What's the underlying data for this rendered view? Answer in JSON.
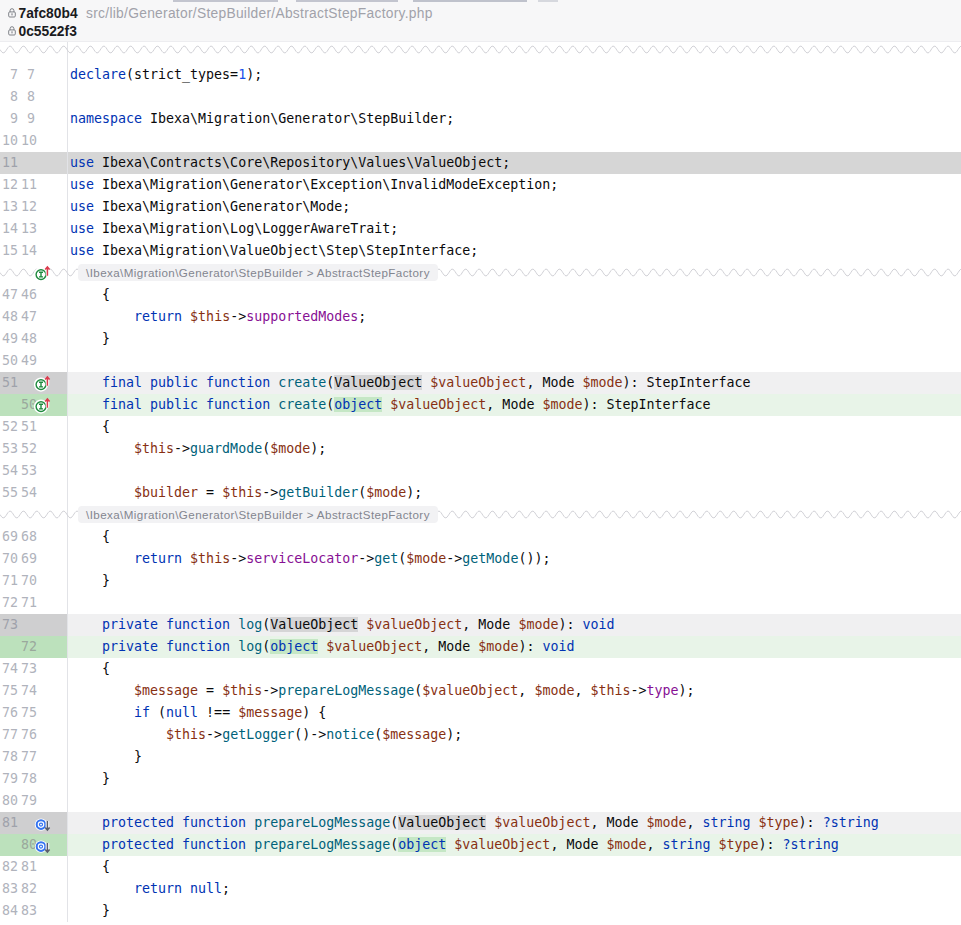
{
  "header": {
    "commit_old": "7afc80b4",
    "commit_new": "0c5522f3",
    "file_path": "src/lib/Generator/StepBuilder/AbstractStepFactory.php"
  },
  "diff_colors": {
    "deleted_line_bg": "#d6d6d6",
    "deleted_word_bg": "#d5d5d6",
    "deleted_soft_bg": "#f0f0f1",
    "added_gutter_bg": "#bce1bc",
    "added_word_bg": "#c5e7c5",
    "added_soft_bg": "#e8f4e8"
  },
  "rows": [
    {
      "t": "fold"
    },
    {
      "t": "ctx",
      "old": "7",
      "new": "7",
      "tokens": [
        [
          "keyword",
          "declare"
        ],
        [
          "plain",
          "(strict_types="
        ],
        [
          "number",
          "1"
        ],
        [
          "plain",
          ");"
        ]
      ]
    },
    {
      "t": "ctx",
      "old": "8",
      "new": "8",
      "tokens": []
    },
    {
      "t": "ctx",
      "old": "9",
      "new": "9",
      "tokens": [
        [
          "keyword",
          "namespace"
        ],
        [
          "plain",
          " Ibexa\\Migration\\Generator\\StepBuilder;"
        ]
      ]
    },
    {
      "t": "ctx",
      "old": "10",
      "new": "10",
      "tokens": []
    },
    {
      "t": "deleted",
      "old": "11",
      "tokens": [
        [
          "keyword",
          "use"
        ],
        [
          "plain",
          " Ibexa\\Contracts\\Core\\Repository\\Values\\ValueObject;"
        ]
      ]
    },
    {
      "t": "ctx",
      "old": "12",
      "new": "11",
      "tokens": [
        [
          "keyword",
          "use"
        ],
        [
          "plain",
          " Ibexa\\Migration\\Generator\\Exception\\InvalidModeException;"
        ]
      ]
    },
    {
      "t": "ctx",
      "old": "13",
      "new": "12",
      "tokens": [
        [
          "keyword",
          "use"
        ],
        [
          "plain",
          " Ibexa\\Migration\\Generator\\Mode;"
        ]
      ]
    },
    {
      "t": "ctx",
      "old": "14",
      "new": "13",
      "tokens": [
        [
          "keyword",
          "use"
        ],
        [
          "plain",
          " Ibexa\\Migration\\Log\\LoggerAwareTrait;"
        ]
      ]
    },
    {
      "t": "ctx",
      "old": "15",
      "new": "14",
      "tokens": [
        [
          "keyword",
          "use"
        ],
        [
          "plain",
          " Ibexa\\Migration\\ValueObject\\Step\\StepInterface;"
        ]
      ]
    },
    {
      "t": "fold",
      "label": "\\Ibexa\\Migration\\Generator\\StepBuilder > AbstractStepFactory",
      "icon": "implements-interface-icon"
    },
    {
      "t": "ctx",
      "old": "47",
      "new": "46",
      "tokens": [
        [
          "plain",
          "    {"
        ]
      ]
    },
    {
      "t": "ctx",
      "old": "48",
      "new": "47",
      "tokens": [
        [
          "plain",
          "        "
        ],
        [
          "keyword",
          "return"
        ],
        [
          "plain",
          " "
        ],
        [
          "variable",
          "$this"
        ],
        [
          "plain",
          "->"
        ],
        [
          "field",
          "supportedModes"
        ],
        [
          "plain",
          ";"
        ]
      ]
    },
    {
      "t": "ctx",
      "old": "49",
      "new": "48",
      "tokens": [
        [
          "plain",
          "    }"
        ]
      ]
    },
    {
      "t": "ctx",
      "old": "50",
      "new": "49",
      "tokens": []
    },
    {
      "t": "del-mod",
      "old": "51",
      "icon": "implements-interface-icon",
      "tokens": [
        [
          "plain",
          "    "
        ],
        [
          "keyword",
          "final public function "
        ],
        [
          "function",
          "create"
        ],
        [
          "plain",
          "("
        ],
        [
          "plain",
          "ValueObject",
          "changed"
        ],
        [
          "plain",
          " "
        ],
        [
          "variable",
          "$valueObject"
        ],
        [
          "plain",
          ", Mode "
        ],
        [
          "variable",
          "$mode"
        ],
        [
          "plain",
          "): StepInterface"
        ]
      ]
    },
    {
      "t": "add-mod",
      "new": "50",
      "icon": "implements-interface-icon",
      "tokens": [
        [
          "plain",
          "    "
        ],
        [
          "keyword",
          "final public function "
        ],
        [
          "function",
          "create"
        ],
        [
          "plain",
          "("
        ],
        [
          "keyword",
          "object",
          "changed"
        ],
        [
          "plain",
          " "
        ],
        [
          "variable",
          "$valueObject"
        ],
        [
          "plain",
          ", Mode "
        ],
        [
          "variable",
          "$mode"
        ],
        [
          "plain",
          "): StepInterface"
        ]
      ]
    },
    {
      "t": "ctx",
      "old": "52",
      "new": "51",
      "tokens": [
        [
          "plain",
          "    {"
        ]
      ]
    },
    {
      "t": "ctx",
      "old": "53",
      "new": "52",
      "tokens": [
        [
          "plain",
          "        "
        ],
        [
          "variable",
          "$this"
        ],
        [
          "plain",
          "->"
        ],
        [
          "function",
          "guardMode"
        ],
        [
          "plain",
          "("
        ],
        [
          "variable",
          "$mode"
        ],
        [
          "plain",
          ");"
        ]
      ]
    },
    {
      "t": "ctx",
      "old": "54",
      "new": "53",
      "tokens": []
    },
    {
      "t": "ctx",
      "old": "55",
      "new": "54",
      "tokens": [
        [
          "plain",
          "        "
        ],
        [
          "variable",
          "$builder"
        ],
        [
          "plain",
          " = "
        ],
        [
          "variable",
          "$this"
        ],
        [
          "plain",
          "->"
        ],
        [
          "function",
          "getBuilder"
        ],
        [
          "plain",
          "("
        ],
        [
          "variable",
          "$mode"
        ],
        [
          "plain",
          ");"
        ]
      ]
    },
    {
      "t": "fold",
      "label": "\\Ibexa\\Migration\\Generator\\StepBuilder > AbstractStepFactory"
    },
    {
      "t": "ctx",
      "old": "69",
      "new": "68",
      "tokens": [
        [
          "plain",
          "    {"
        ]
      ]
    },
    {
      "t": "ctx",
      "old": "70",
      "new": "69",
      "tokens": [
        [
          "plain",
          "        "
        ],
        [
          "keyword",
          "return"
        ],
        [
          "plain",
          " "
        ],
        [
          "variable",
          "$this"
        ],
        [
          "plain",
          "->"
        ],
        [
          "field",
          "serviceLocator"
        ],
        [
          "plain",
          "->"
        ],
        [
          "function",
          "get"
        ],
        [
          "plain",
          "("
        ],
        [
          "variable",
          "$mode"
        ],
        [
          "plain",
          "->"
        ],
        [
          "function",
          "getMode"
        ],
        [
          "plain",
          "());"
        ]
      ]
    },
    {
      "t": "ctx",
      "old": "71",
      "new": "70",
      "tokens": [
        [
          "plain",
          "    }"
        ]
      ]
    },
    {
      "t": "ctx",
      "old": "72",
      "new": "71",
      "tokens": []
    },
    {
      "t": "del-mod",
      "old": "73",
      "tokens": [
        [
          "plain",
          "    "
        ],
        [
          "keyword",
          "private function "
        ],
        [
          "function",
          "log"
        ],
        [
          "plain",
          "("
        ],
        [
          "plain",
          "ValueObject",
          "changed"
        ],
        [
          "plain",
          " "
        ],
        [
          "variable",
          "$valueObject"
        ],
        [
          "plain",
          ", Mode "
        ],
        [
          "variable",
          "$mode"
        ],
        [
          "plain",
          "): "
        ],
        [
          "keyword",
          "void"
        ]
      ]
    },
    {
      "t": "add-mod",
      "new": "72",
      "tokens": [
        [
          "plain",
          "    "
        ],
        [
          "keyword",
          "private function "
        ],
        [
          "function",
          "log"
        ],
        [
          "plain",
          "("
        ],
        [
          "keyword",
          "object",
          "changed"
        ],
        [
          "plain",
          " "
        ],
        [
          "variable",
          "$valueObject"
        ],
        [
          "plain",
          ", Mode "
        ],
        [
          "variable",
          "$mode"
        ],
        [
          "plain",
          "): "
        ],
        [
          "keyword",
          "void"
        ]
      ]
    },
    {
      "t": "ctx",
      "old": "74",
      "new": "73",
      "tokens": [
        [
          "plain",
          "    {"
        ]
      ]
    },
    {
      "t": "ctx",
      "old": "75",
      "new": "74",
      "tokens": [
        [
          "plain",
          "        "
        ],
        [
          "variable",
          "$message"
        ],
        [
          "plain",
          " = "
        ],
        [
          "variable",
          "$this"
        ],
        [
          "plain",
          "->"
        ],
        [
          "function",
          "prepareLogMessage"
        ],
        [
          "plain",
          "("
        ],
        [
          "variable",
          "$valueObject"
        ],
        [
          "plain",
          ", "
        ],
        [
          "variable",
          "$mode"
        ],
        [
          "plain",
          ", "
        ],
        [
          "variable",
          "$this"
        ],
        [
          "plain",
          "->"
        ],
        [
          "field",
          "type"
        ],
        [
          "plain",
          ");"
        ]
      ]
    },
    {
      "t": "ctx",
      "old": "76",
      "new": "75",
      "tokens": [
        [
          "plain",
          "        "
        ],
        [
          "keyword",
          "if"
        ],
        [
          "plain",
          " ("
        ],
        [
          "keyword",
          "null"
        ],
        [
          "plain",
          " !== "
        ],
        [
          "variable",
          "$message"
        ],
        [
          "plain",
          ") {"
        ]
      ]
    },
    {
      "t": "ctx",
      "old": "77",
      "new": "76",
      "tokens": [
        [
          "plain",
          "            "
        ],
        [
          "variable",
          "$this"
        ],
        [
          "plain",
          "->"
        ],
        [
          "function",
          "getLogger"
        ],
        [
          "plain",
          "()->"
        ],
        [
          "function",
          "notice"
        ],
        [
          "plain",
          "("
        ],
        [
          "variable",
          "$message"
        ],
        [
          "plain",
          ");"
        ]
      ]
    },
    {
      "t": "ctx",
      "old": "78",
      "new": "77",
      "tokens": [
        [
          "plain",
          "        }"
        ]
      ]
    },
    {
      "t": "ctx",
      "old": "79",
      "new": "78",
      "tokens": [
        [
          "plain",
          "    }"
        ]
      ]
    },
    {
      "t": "ctx",
      "old": "80",
      "new": "79",
      "tokens": []
    },
    {
      "t": "del-mod",
      "old": "81",
      "icon": "overridden-method-icon",
      "tokens": [
        [
          "plain",
          "    "
        ],
        [
          "keyword",
          "protected function "
        ],
        [
          "function",
          "prepareLogMessage"
        ],
        [
          "plain",
          "("
        ],
        [
          "plain",
          "ValueObject",
          "changed"
        ],
        [
          "plain",
          " "
        ],
        [
          "variable",
          "$valueObject"
        ],
        [
          "plain",
          ", Mode "
        ],
        [
          "variable",
          "$mode"
        ],
        [
          "plain",
          ", "
        ],
        [
          "keyword",
          "string"
        ],
        [
          "plain",
          " "
        ],
        [
          "variable",
          "$type"
        ],
        [
          "plain",
          "): "
        ],
        [
          "keyword",
          "?string"
        ]
      ]
    },
    {
      "t": "add-mod",
      "new": "80",
      "icon": "overridden-method-icon",
      "tokens": [
        [
          "plain",
          "    "
        ],
        [
          "keyword",
          "protected function "
        ],
        [
          "function",
          "prepareLogMessage"
        ],
        [
          "plain",
          "("
        ],
        [
          "keyword",
          "object",
          "changed"
        ],
        [
          "plain",
          " "
        ],
        [
          "variable",
          "$valueObject"
        ],
        [
          "plain",
          ", Mode "
        ],
        [
          "variable",
          "$mode"
        ],
        [
          "plain",
          ", "
        ],
        [
          "keyword",
          "string"
        ],
        [
          "plain",
          " "
        ],
        [
          "variable",
          "$type"
        ],
        [
          "plain",
          "): "
        ],
        [
          "keyword",
          "?string"
        ]
      ]
    },
    {
      "t": "ctx",
      "old": "82",
      "new": "81",
      "tokens": [
        [
          "plain",
          "    {"
        ]
      ]
    },
    {
      "t": "ctx",
      "old": "83",
      "new": "82",
      "tokens": [
        [
          "plain",
          "        "
        ],
        [
          "keyword",
          "return null"
        ],
        [
          "plain",
          ";"
        ]
      ]
    },
    {
      "t": "ctx",
      "old": "84",
      "new": "83",
      "tokens": [
        [
          "plain",
          "    }"
        ]
      ]
    }
  ]
}
